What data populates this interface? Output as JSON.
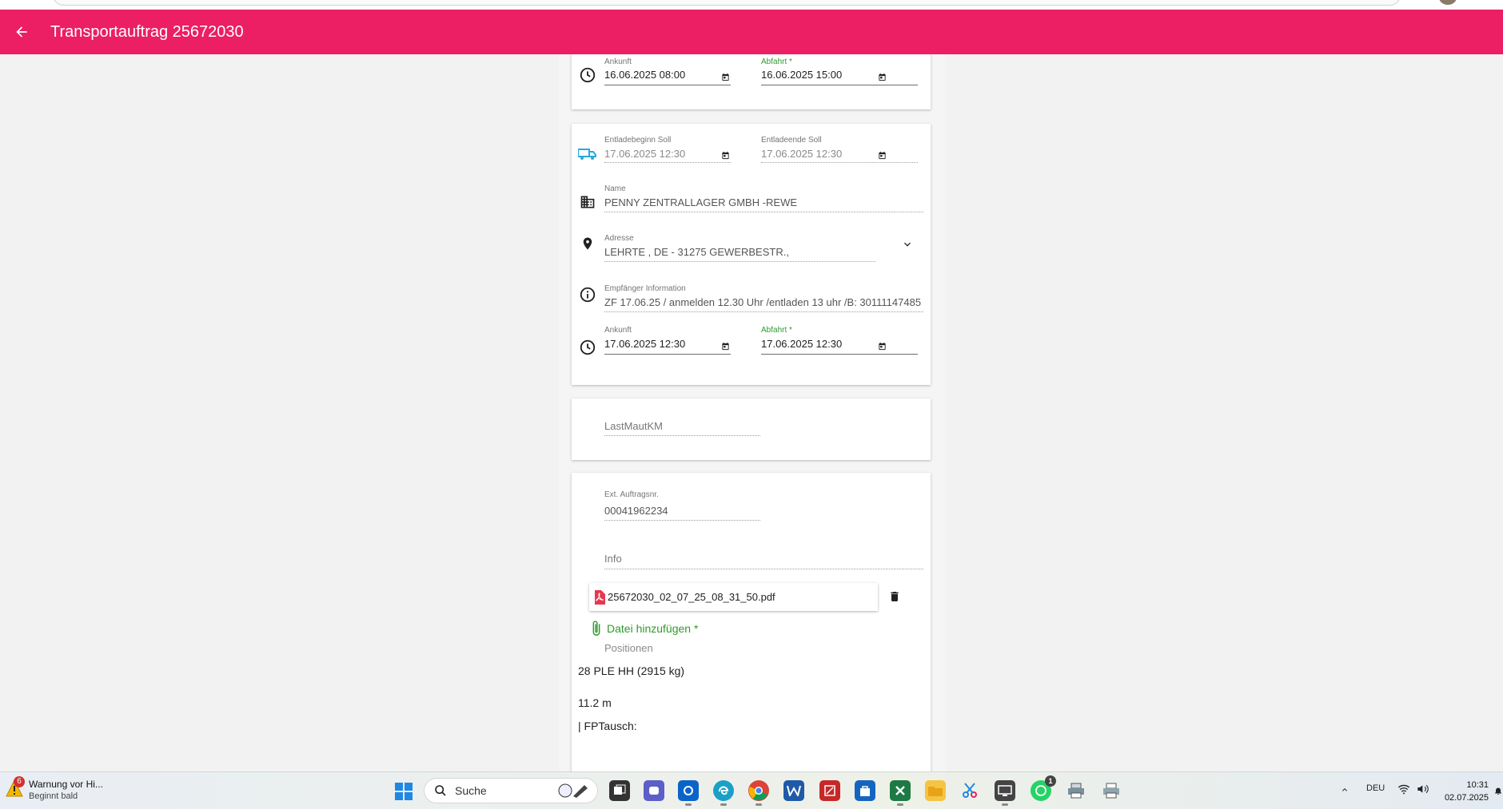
{
  "appbar": {
    "title": "Transportauftrag 25672030"
  },
  "loading_card": {
    "ankunft_label": "Ankunft",
    "ankunft_value": "16.06.2025 08:00",
    "abfahrt_label": "Abfahrt *",
    "abfahrt_value": "16.06.2025 15:00"
  },
  "unloading_card": {
    "entladebeginn_label": "Entladebeginn Soll",
    "entladebeginn_value": "17.06.2025 12:30",
    "entladeende_label": "Entladeende Soll",
    "entladeende_value": "17.06.2025 12:30",
    "name_label": "Name",
    "name_value": "PENNY ZENTRALLAGER GMBH -REWE",
    "adresse_label": "Adresse",
    "adresse_value": "LEHRTE , DE - 31275 GEWERBESTR.,",
    "info_label": "Empfänger Information",
    "info_value": "ZF 17.06.25 / anmelden 12.30 Uhr /entladen 13 uhr /B: 30111147485",
    "ankunft_label": "Ankunft",
    "ankunft_value": "17.06.2025 12:30",
    "abfahrt_label": "Abfahrt *",
    "abfahrt_value": "17.06.2025 12:30"
  },
  "maut_card": {
    "placeholder": "LastMautKM"
  },
  "order_card": {
    "ext_label": "Ext. Auftragsnr.",
    "ext_value": "00041962234",
    "info_placeholder": "Info",
    "file_name": "25672030_02_07_25_08_31_50.pdf",
    "add_file_label": "Datei hinzufügen *",
    "positionen_label": "Positionen",
    "position_weight": "28 PLE HH (2915 kg)",
    "position_length": "11.2 m",
    "fptausch": "| FPTausch:"
  },
  "taskbar": {
    "notif_title": "Warnung vor Hi...",
    "notif_sub": "Beginnt bald",
    "notif_count": "6",
    "search_label": "Suche",
    "whatsapp_badge": "1",
    "language": "DEU",
    "time": "10:31",
    "date": "02.07.2025"
  },
  "colors": {
    "appbar": "#ec1e64",
    "accent_green": "#2e9a2e",
    "truck_blue": "#29a8e0"
  }
}
